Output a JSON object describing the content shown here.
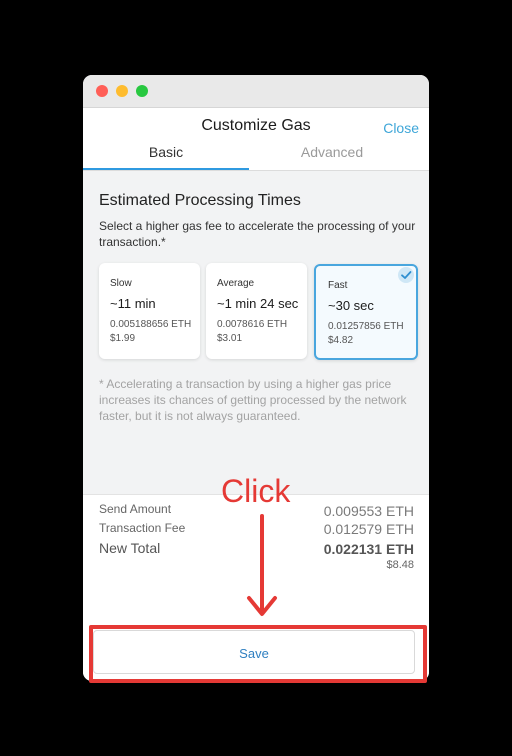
{
  "header": {
    "title": "Customize Gas",
    "close_label": "Close"
  },
  "tabs": [
    {
      "label": "Basic",
      "active": true
    },
    {
      "label": "Advanced",
      "active": false
    }
  ],
  "estimates": {
    "title": "Estimated Processing Times",
    "description": "Select a higher gas fee to accelerate the processing of your transaction.*",
    "options": [
      {
        "label": "Slow",
        "time": "~11 min",
        "eth": "0.005188656 ETH",
        "usd": "$1.99",
        "selected": false
      },
      {
        "label": "Average",
        "time": "~1 min 24 sec",
        "eth": "0.0078616 ETH",
        "usd": "$3.01",
        "selected": false
      },
      {
        "label": "Fast",
        "time": "~30 sec",
        "eth": "0.01257856 ETH",
        "usd": "$4.82",
        "selected": true
      }
    ],
    "note": "* Accelerating a transaction by using a higher gas price increases its chances of getting processed by the network faster, but it is not always guaranteed."
  },
  "summary": {
    "send_amount_label": "Send Amount",
    "send_amount_value": "0.009553 ETH",
    "transaction_fee_label": "Transaction Fee",
    "transaction_fee_value": "0.012579 ETH",
    "new_total_label": "New Total",
    "new_total_value": "0.022131 ETH",
    "new_total_usd": "$8.48"
  },
  "footer": {
    "save_label": "Save"
  },
  "annotation": {
    "text": "Click",
    "color": "#e53935"
  },
  "colors": {
    "accent": "#2f9ae0",
    "selected_border": "#49a6de"
  }
}
